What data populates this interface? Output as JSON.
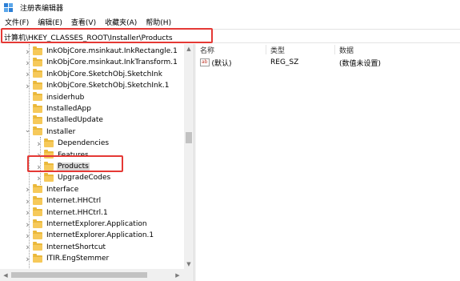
{
  "window": {
    "title": "注册表编辑器"
  },
  "menu": [
    "文件(F)",
    "编辑(E)",
    "查看(V)",
    "收藏夹(A)",
    "帮助(H)"
  ],
  "address": "计算机\\HKEY_CLASSES_ROOT\\Installer\\Products",
  "tree": [
    {
      "label": "InkObjCore.msinkaut.InkRectangle.1",
      "level": 2,
      "expander": true
    },
    {
      "label": "InkObjCore.msinkaut.InkTransform.1",
      "level": 2,
      "expander": true
    },
    {
      "label": "InkObjCore.SketchObj.SketchInk",
      "level": 2,
      "expander": true
    },
    {
      "label": "InkObjCore.SketchObj.SketchInk.1",
      "level": 2,
      "expander": true
    },
    {
      "label": "insiderhub",
      "level": 2,
      "expander": false
    },
    {
      "label": "InstalledApp",
      "level": 2,
      "expander": false
    },
    {
      "label": "InstalledUpdate",
      "level": 2,
      "expander": false
    },
    {
      "label": "Installer",
      "level": 2,
      "expander": true,
      "expanded": true
    },
    {
      "label": "Dependencies",
      "level": 3,
      "expander": true
    },
    {
      "label": "Features",
      "level": 3,
      "expander": true
    },
    {
      "label": "Products",
      "level": 3,
      "expander": true,
      "selected": true
    },
    {
      "label": "UpgradeCodes",
      "level": 3,
      "expander": true
    },
    {
      "label": "Interface",
      "level": 2,
      "expander": true
    },
    {
      "label": "Internet.HHCtrl",
      "level": 2,
      "expander": true
    },
    {
      "label": "Internet.HHCtrl.1",
      "level": 2,
      "expander": true
    },
    {
      "label": "InternetExplorer.Application",
      "level": 2,
      "expander": true
    },
    {
      "label": "InternetExplorer.Application.1",
      "level": 2,
      "expander": true
    },
    {
      "label": "InternetShortcut",
      "level": 2,
      "expander": true
    },
    {
      "label": "ITIR.EngStemmer",
      "level": 2,
      "expander": true
    }
  ],
  "columns": {
    "name": "名称",
    "type": "类型",
    "data": "数据"
  },
  "values": [
    {
      "icon": "ab",
      "name": "(默认)",
      "type": "REG_SZ",
      "data": "(数值未设置)"
    }
  ],
  "colors": {
    "highlight": "#e53935",
    "folder": "#f6c95a",
    "selection": "#d8d8d8"
  }
}
